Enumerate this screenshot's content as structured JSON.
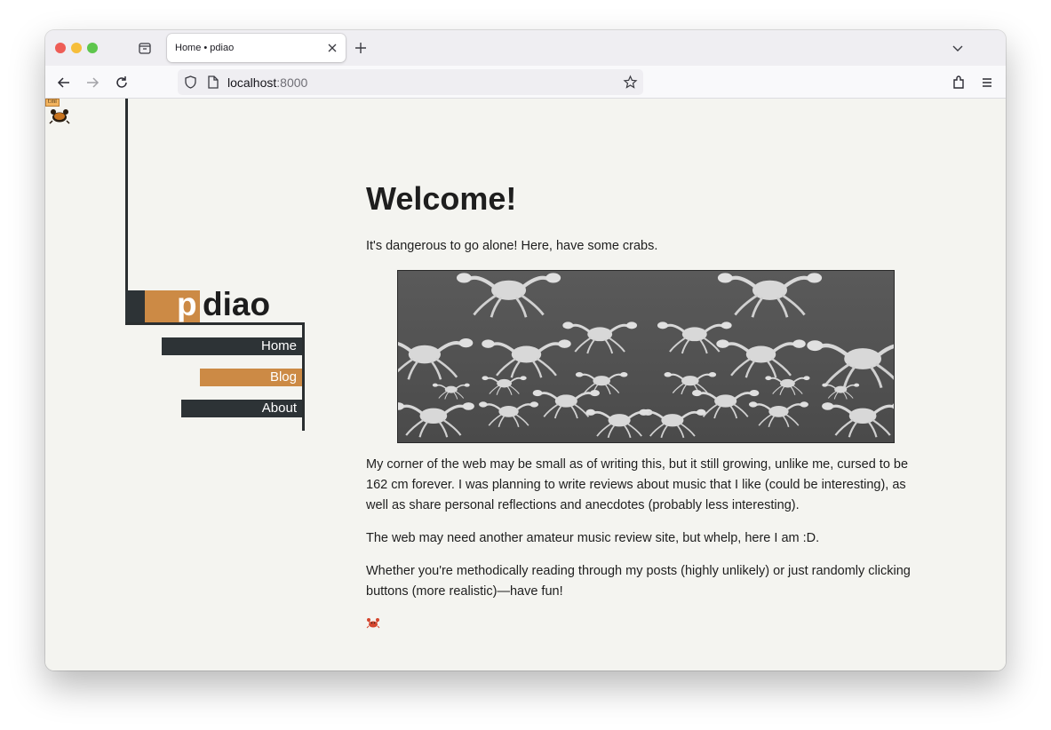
{
  "browser": {
    "tab_title": "Home • pdiao",
    "url_host": "localhost",
    "url_port": ":8000"
  },
  "debug": {
    "tag": "t:ml"
  },
  "site": {
    "logo_first": "p",
    "logo_rest": "diao",
    "nav": [
      {
        "label": "Home"
      },
      {
        "label": "Blog"
      },
      {
        "label": "About"
      }
    ]
  },
  "article": {
    "heading": "Welcome!",
    "intro": "It's dangerous to go alone! Here, have some crabs.",
    "paragraphs": [
      "My corner of the web may be small as of writing this, but it still growing, unlike me, cursed to be 162 cm forever. I was planning to write reviews about music that I like (could be interesting), as well as share personal reflections and anecdotes (probably less interesting).",
      "The web may need another amateur music review site, but whelp, here I am :D.",
      "Whether you're methodically reading through my posts (highly unlikely) or just randomly clicking buttons (more realistic)—have fun!"
    ]
  },
  "icons": {
    "crab_emoji": "crab-icon"
  },
  "colors": {
    "accent": "#cc8a45",
    "dark": "#2d3336",
    "background": "#f4f4f0"
  }
}
